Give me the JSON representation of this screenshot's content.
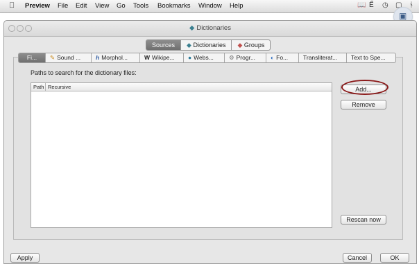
{
  "menubar": {
    "app": "Preview",
    "items": [
      "File",
      "Edit",
      "View",
      "Go",
      "Tools",
      "Bookmarks",
      "Window",
      "Help"
    ]
  },
  "window": {
    "title": "Dictionaries",
    "segments": [
      "Sources",
      "Dictionaries",
      "Groups"
    ],
    "active_segment": "Sources",
    "tabs": [
      "Fi...",
      "Sound ...",
      "Morphol...",
      "Wikipe...",
      "Webs...",
      "Progr...",
      "Fo...",
      "Transliterat...",
      "Text to Spe..."
    ],
    "active_tab": "Fi...",
    "paths_label": "Paths to search for the dictionary files:",
    "table": {
      "columns": [
        "Path",
        "Recursive"
      ],
      "rows": []
    },
    "buttons": {
      "add": "Add...",
      "remove": "Remove",
      "rescan": "Rescan now",
      "apply": "Apply",
      "cancel": "Cancel",
      "ok": "OK"
    }
  },
  "colors": {
    "highlight_ring": "#8b1a1a",
    "active_segment": "#7a7a7a"
  }
}
